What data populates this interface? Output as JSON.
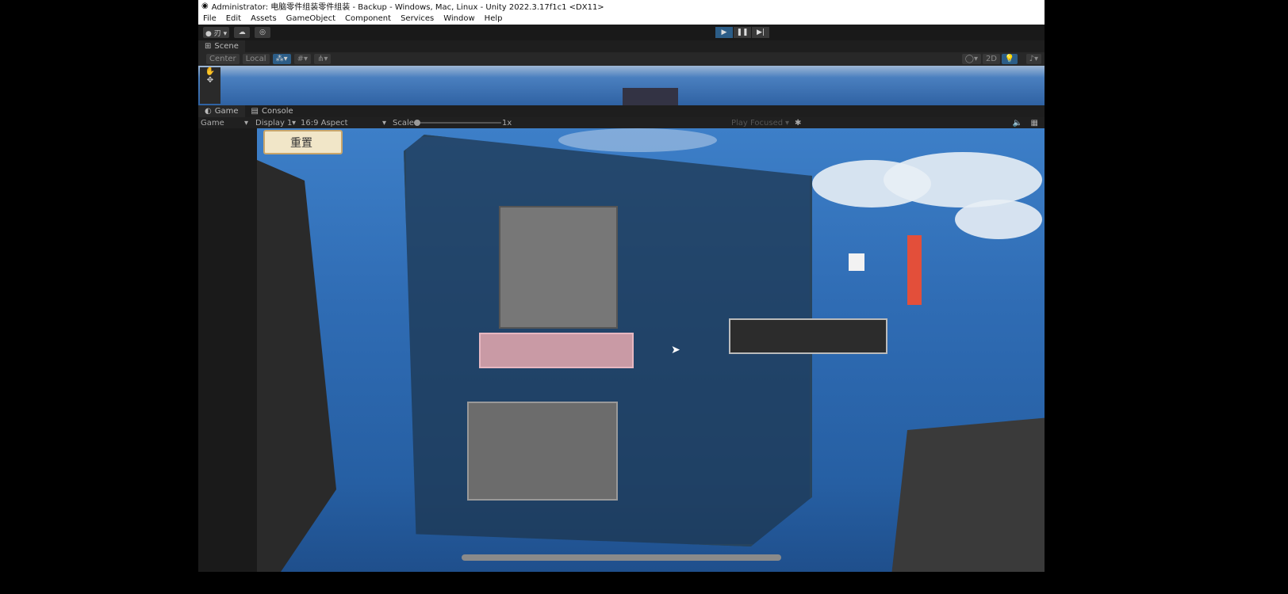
{
  "title": "Administrator: 电脑零件组装零件组装 - Backup - Windows, Mac, Linux - Unity 2022.3.17f1c1 <DX11>",
  "menu": [
    "File",
    "Edit",
    "Assets",
    "GameObject",
    "Component",
    "Services",
    "Window",
    "Help"
  ],
  "toolbar": {
    "account": "● 刃 ▾",
    "cloud": "☁",
    "settings": "◎",
    "play": "▶",
    "pause": "❚❚",
    "step": "▶|"
  },
  "scene": {
    "tab": "Scene",
    "pivot": "Center",
    "space": "Local",
    "mode_2d": "2D"
  },
  "game": {
    "tab_game": "Game",
    "tab_console": "Console",
    "view": "Game",
    "display": "Display 1",
    "aspect": "16:9 Aspect",
    "scale_label": "Scale",
    "scale_value": "1x",
    "play_mode": "Play Focused",
    "reset_button": "重置"
  }
}
